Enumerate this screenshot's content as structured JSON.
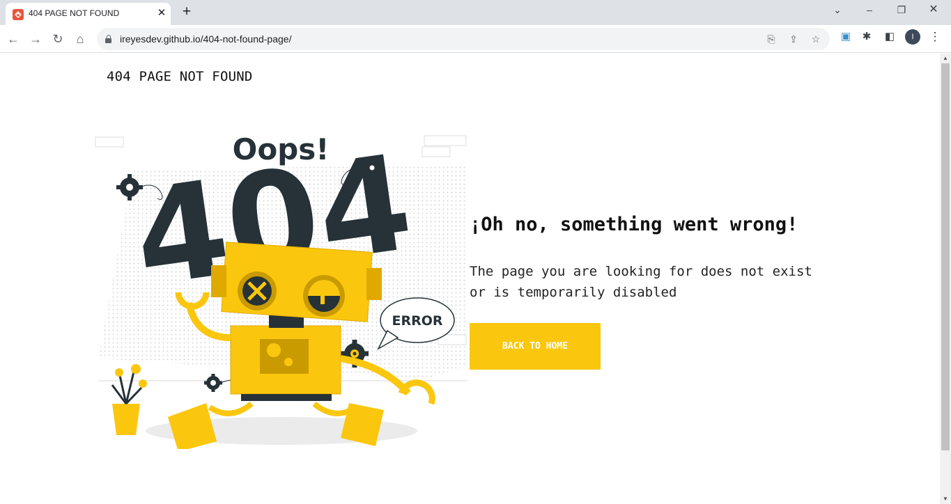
{
  "browser": {
    "tab_title": "404 PAGE NOT FOUND",
    "url": "ireyesdev.github.io/404-not-found-page/",
    "new_tab_label": "+",
    "avatar_initial": "I"
  },
  "page": {
    "header": "404 PAGE NOT FOUND",
    "illustration": {
      "oops_text": "Oops!",
      "big_number": "404",
      "bubble_text": "ERROR"
    },
    "headline": "¡Oh no, something went wrong!",
    "description_line1": "The page you are looking for does not exist",
    "description_line2": "or is temporarily disabled",
    "button_label": "BACK TO HOME"
  },
  "colors": {
    "accent": "#fbc70e",
    "dark": "#263238",
    "text": "#111111"
  },
  "icons": {
    "favicon": "site-favicon",
    "back": "arrow-left-icon",
    "forward": "arrow-right-icon",
    "reload": "reload-icon",
    "home": "home-icon",
    "lock": "lock-icon",
    "translate": "translate-icon",
    "share": "share-icon",
    "bookmark": "star-icon",
    "extension": "puzzle-icon",
    "sidepanel": "side-panel-icon",
    "menu": "kebab-menu-icon"
  }
}
